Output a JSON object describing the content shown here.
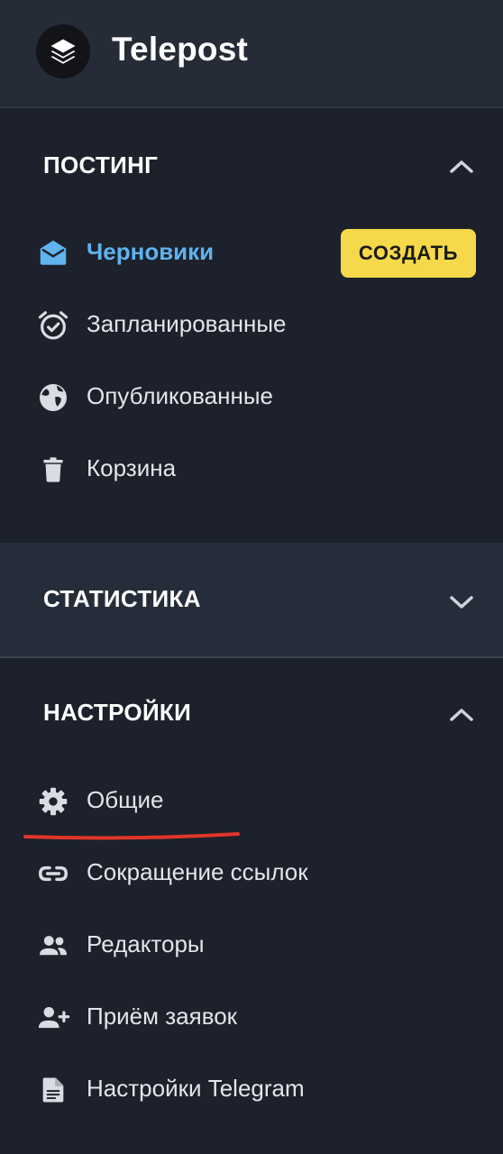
{
  "app": {
    "title": "Telepost",
    "logo_icon": "layers-icon"
  },
  "sections": {
    "posting": {
      "title": "ПОСТИНГ",
      "expanded": true,
      "items": [
        {
          "label": "Черновики",
          "icon": "envelope-open-icon",
          "active": true
        },
        {
          "label": "Запланированные",
          "icon": "alarm-clock-icon",
          "active": false
        },
        {
          "label": "Опубликованные",
          "icon": "globe-icon",
          "active": false
        },
        {
          "label": "Корзина",
          "icon": "trash-icon",
          "active": false
        }
      ],
      "create_button": "СОЗДАТЬ"
    },
    "statistics": {
      "title": "СТАТИСТИКА",
      "expanded": false
    },
    "settings": {
      "title": "НАСТРОЙКИ",
      "expanded": true,
      "items": [
        {
          "label": "Общие",
          "icon": "gear-icon",
          "active": false
        },
        {
          "label": "Сокращение ссылок",
          "icon": "link-icon",
          "active": false
        },
        {
          "label": "Редакторы",
          "icon": "people-icon",
          "active": false
        },
        {
          "label": "Приём заявок",
          "icon": "person-add-icon",
          "active": false
        },
        {
          "label": "Настройки Telegram",
          "icon": "document-icon",
          "active": false
        }
      ]
    }
  },
  "colors": {
    "background": "#1c212b",
    "header": "#252c38",
    "active": "#5fb3ef",
    "create_button": "#f6d94a",
    "annotation_underline": "#e0352a"
  }
}
